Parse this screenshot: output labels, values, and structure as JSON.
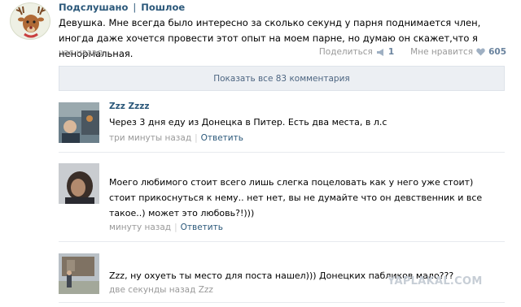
{
  "post": {
    "group_name": "Подслушано",
    "separator": "|",
    "group_suffix": "Пошлое",
    "text": "Девушка. Мне всегда было интересно за сколько секунд у парня поднимается член, иногда даже хочется провести этот опыт на моем парне, но думаю он скажет,что я ненормальная.",
    "time": "час назад",
    "share_label": "Поделиться",
    "share_count": "1",
    "like_label": "Мне нравится",
    "like_count": "605"
  },
  "show_all": {
    "label": "Показать все 83 комментария"
  },
  "comments": [
    {
      "author": "Zzz Zzzz",
      "text": "Через 3 дня еду из Донецка в Питер. Есть два места, в л.с",
      "time": "три минуты назад",
      "divider": "|",
      "reply": "Ответить"
    },
    {
      "author": "",
      "text": "Моего любимого стоит всего лишь слегка поцеловать как у него уже стоит) стоит прикоснуться к нему.. нет нет, вы не думайте что он девственник и все такое..) может это любовь?!)))",
      "time": "минуту назад",
      "divider": "|",
      "reply": "Ответить"
    },
    {
      "author": "",
      "text": "Zzz, ну охуеть ты место для поста нашел))) Донецких пабликов мало???",
      "time": "две секунды назад Zzz",
      "divider": "",
      "reply": ""
    }
  ],
  "watermark": "YAPLAKAL.COM",
  "colors": {
    "link": "#2b587a",
    "meta": "#999999",
    "button_bg": "#eceff3",
    "button_text": "#4e6682"
  },
  "icons": {
    "share": "megaphone-icon",
    "like": "heart-icon"
  }
}
